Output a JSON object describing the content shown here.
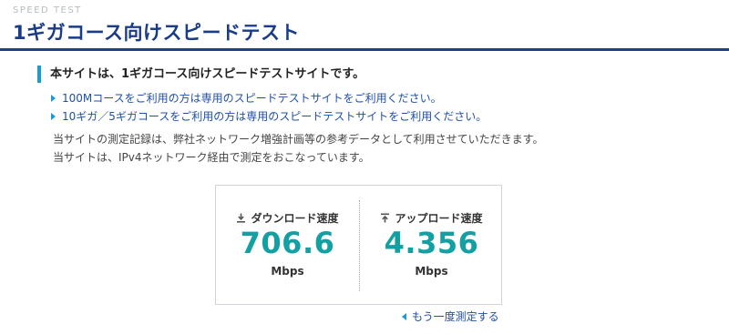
{
  "header": {
    "eyebrow": "SPEED TEST",
    "title": "1ギガコース向けスピードテスト"
  },
  "intro": {
    "heading": "本サイトは、1ギガコース向けスピードテストサイトです。"
  },
  "links": [
    {
      "label": "100Mコースをご利用の方は専用のスピードテストサイトをご利用ください。"
    },
    {
      "label": "10ギガ／5ギガコースをご利用の方は専用のスピードテストサイトをご利用ください。"
    }
  ],
  "notes": [
    "当サイトの測定記録は、弊社ネットワーク増強計画等の参考データとして利用させていただきます。",
    "当サイトは、IPv4ネットワーク経由で測定をおこなっています。"
  ],
  "result": {
    "download": {
      "label": "ダウンロード速度",
      "value": "706.6",
      "unit": "Mbps"
    },
    "upload": {
      "label": "アップロード速度",
      "value": "4.356",
      "unit": "Mbps"
    }
  },
  "retest_label": "もう一度測定する",
  "colors": {
    "title": "#1a3b86",
    "rule": "#1c3f94",
    "accent": "#1a9ad6",
    "link": "#1f4fa6",
    "value": "#13a0a3"
  },
  "icons": {
    "download": "download-icon",
    "upload": "upload-icon",
    "link_marker": "triangle-right-icon",
    "retest_marker": "triangle-left-icon"
  }
}
